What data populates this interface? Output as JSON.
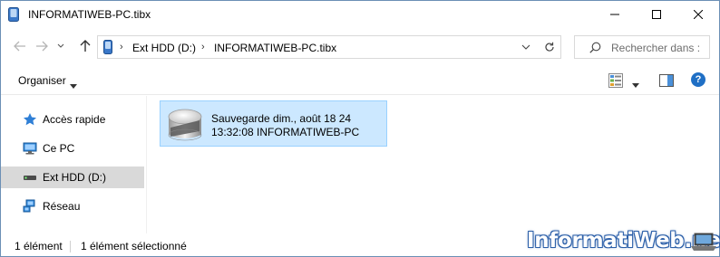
{
  "window": {
    "title": "INFORMATIWEB-PC.tibx"
  },
  "address": {
    "crumbs": [
      "Ext HDD (D:)",
      "INFORMATIWEB-PC.tibx"
    ],
    "search_placeholder": "Rechercher dans :"
  },
  "commandbar": {
    "organize_label": "Organiser"
  },
  "help": {
    "glyph": "?"
  },
  "navpane": {
    "items": [
      {
        "label": "Accès rapide",
        "icon": "star-icon",
        "selected": false
      },
      {
        "label": "Ce PC",
        "icon": "computer-icon",
        "selected": false
      },
      {
        "label": "Ext HDD (D:)",
        "icon": "drive-icon",
        "selected": true
      },
      {
        "label": "Réseau",
        "icon": "network-icon",
        "selected": false
      }
    ]
  },
  "content": {
    "items": [
      {
        "line1": "Sauvegarde dim., août 18 24",
        "line2": "13:32:08 INFORMATIWEB-PC",
        "icon": "backup-disk-icon",
        "selected": true
      }
    ]
  },
  "statusbar": {
    "count": "1 élément",
    "selected": "1 élément sélectionné"
  },
  "watermark": {
    "text": "InformatiWeb.net"
  },
  "colors": {
    "selection_bg": "#cce8ff",
    "selection_border": "#99d1ff",
    "nav_selected_bg": "#d9d9d9",
    "accent": "#1f6fc5"
  }
}
